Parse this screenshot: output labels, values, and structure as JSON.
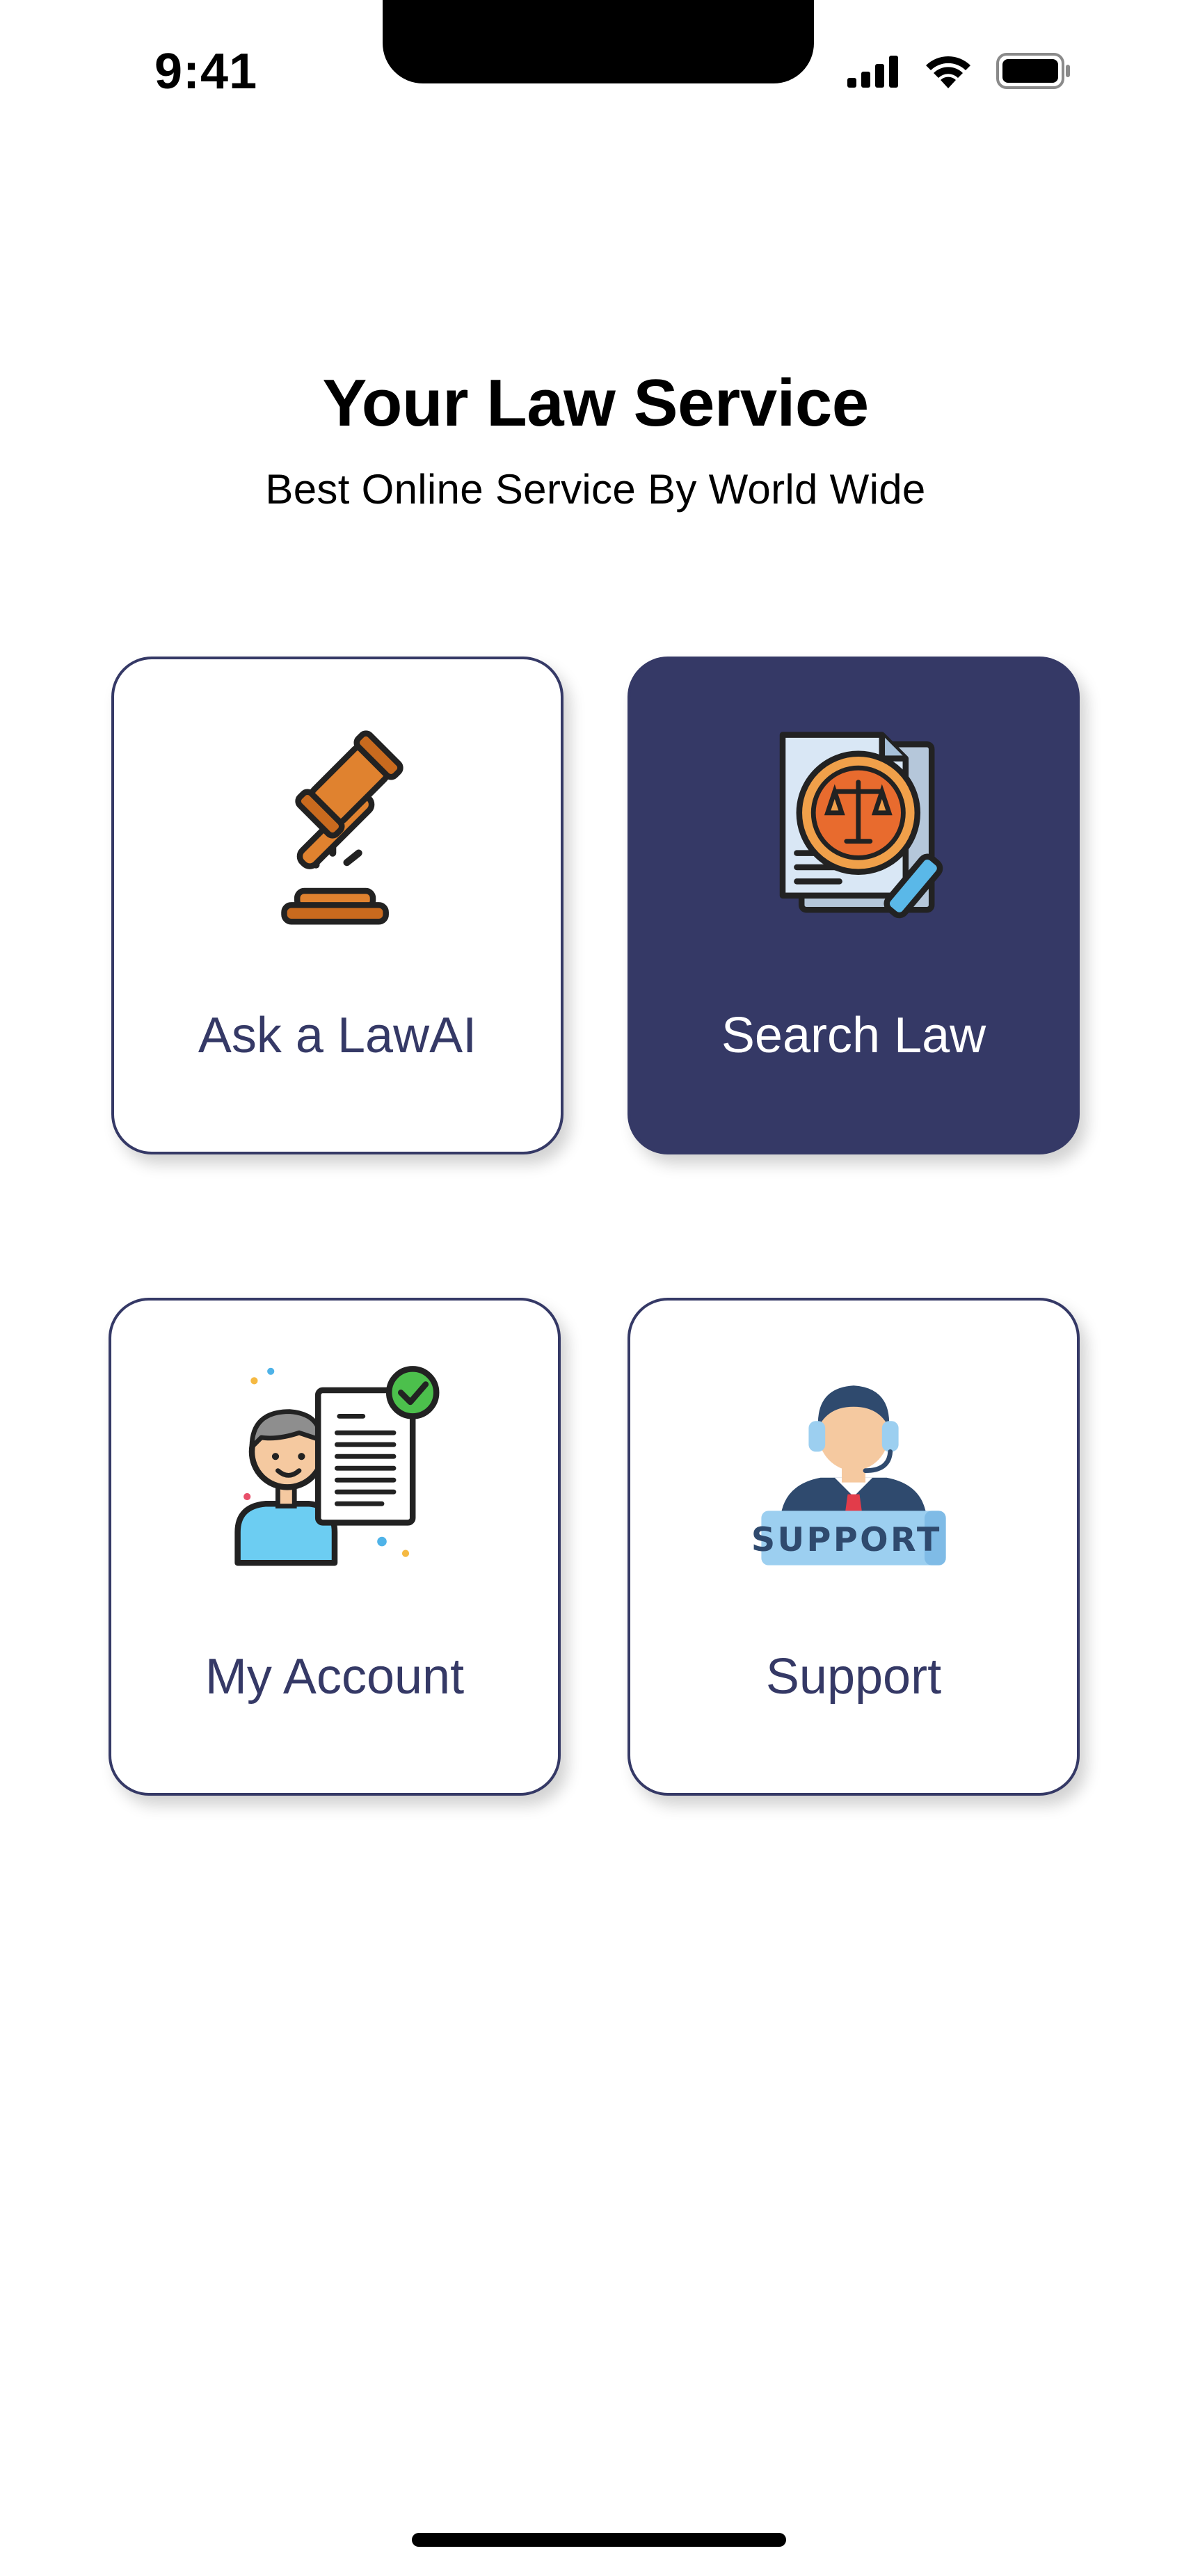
{
  "status_bar": {
    "time": "9:41",
    "icons": [
      "cellular-signal-icon",
      "wifi-icon",
      "battery-icon"
    ]
  },
  "header": {
    "title": "Your Law Service",
    "subtitle": "Best Online Service By World Wide"
  },
  "services": [
    {
      "label": "Ask a LawAI",
      "icon": "gavel-icon",
      "active": false
    },
    {
      "label": "Search Law",
      "icon": "law-document-search-icon",
      "active": true
    },
    {
      "label": "My Account",
      "icon": "user-document-icon",
      "active": false
    },
    {
      "label": "Support",
      "icon": "support-agent-icon",
      "active": false,
      "icon_text": "SUPPORT"
    }
  ],
  "colors": {
    "accent": "#353966",
    "background": "#FFFFFF",
    "text": "#000000"
  }
}
